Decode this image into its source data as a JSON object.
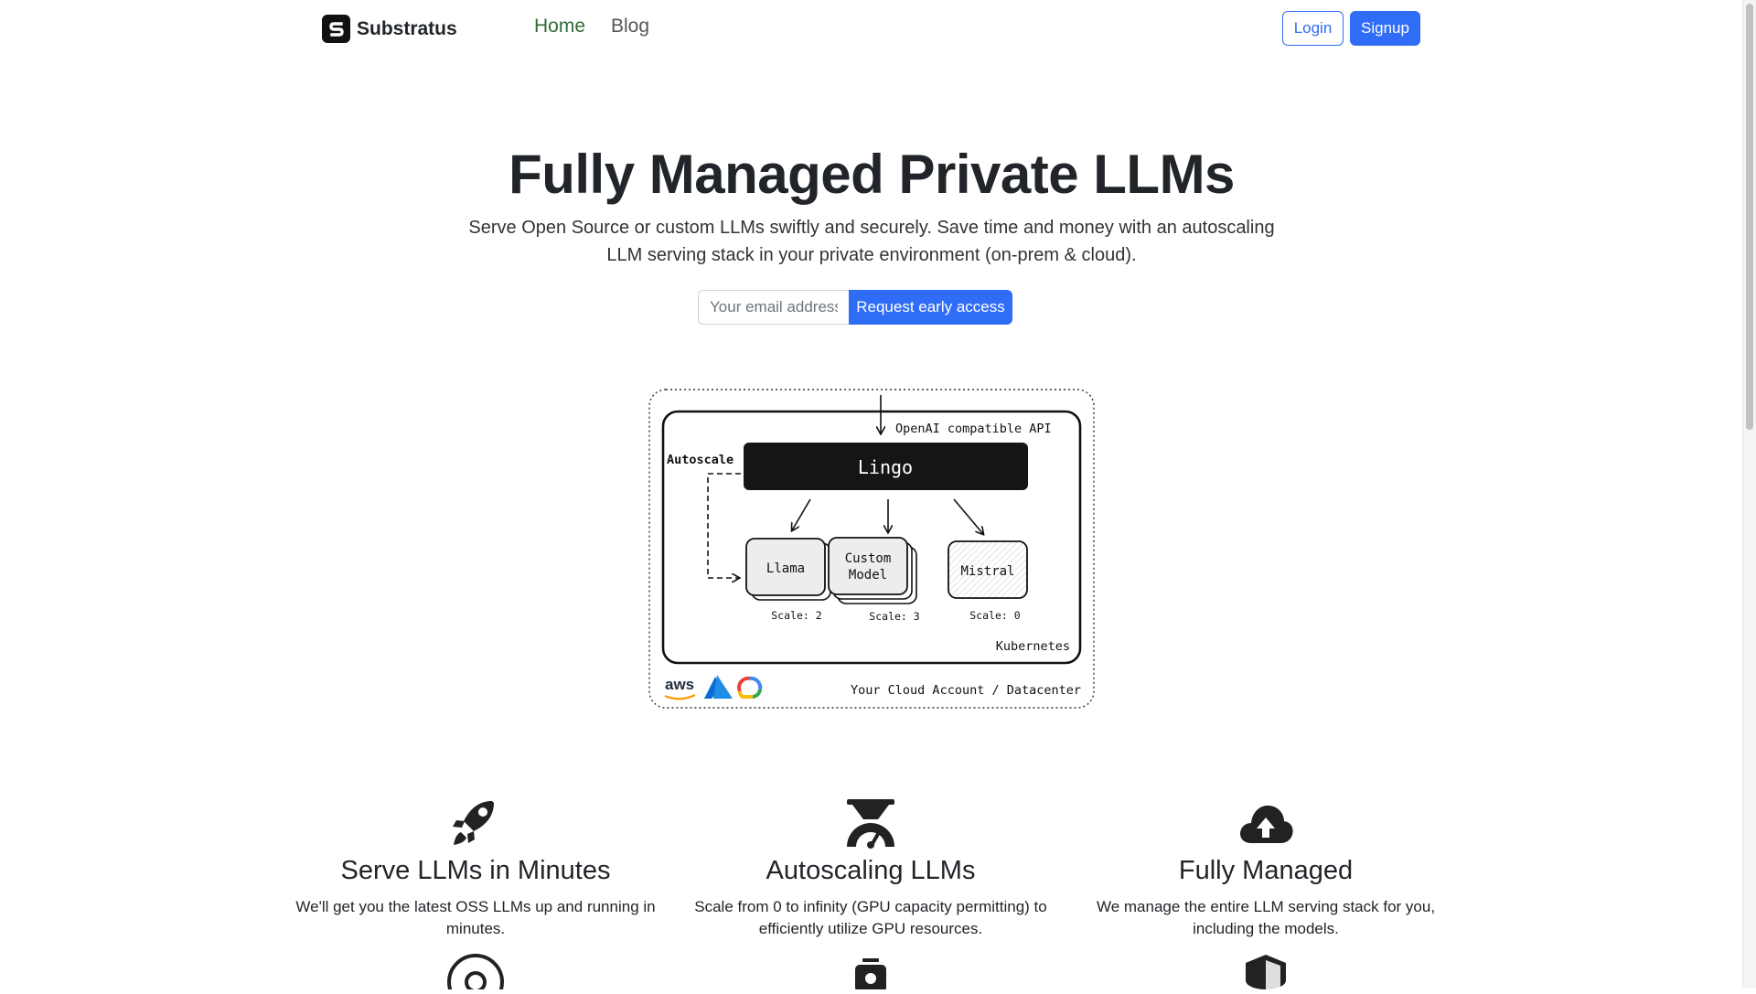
{
  "nav": {
    "brand": "Substratus",
    "links": [
      {
        "label": "Home",
        "active": true
      },
      {
        "label": "Blog",
        "active": false
      }
    ],
    "login_label": "Login",
    "signup_label": "Signup"
  },
  "hero": {
    "title": "Fully Managed Private LLMs",
    "subtitle": "Serve Open Source or custom LLMs swiftly and securely. Save time and money with an autoscaling LLM serving stack in your private environment (on-prem & cloud).",
    "email_placeholder": "Your email address",
    "email_value": "",
    "cta_label": "Request early access"
  },
  "diagram": {
    "api_label": "OpenAI compatible API",
    "router_label": "Lingo",
    "autoscale_label": "Autoscale",
    "models": [
      {
        "name": "Llama",
        "scale": "Scale: 2"
      },
      {
        "name_line1": "Custom",
        "name_line2": "Model",
        "scale": "Scale: 3"
      },
      {
        "name": "Mistral",
        "scale": "Scale: 0"
      }
    ],
    "cluster_label": "Kubernetes",
    "cloud_label": "Your Cloud Account / Datacenter",
    "aws_label": "aws"
  },
  "features": [
    {
      "icon": "rocket-icon",
      "title": "Serve LLMs in Minutes",
      "text": "We'll get you the latest OSS LLMs up and running in minutes."
    },
    {
      "icon": "scale-gauge-icon",
      "title": "Autoscaling LLMs",
      "text": "Scale from 0 to infinity (GPU capacity permitting) to efficiently utilize GPU resources."
    },
    {
      "icon": "cloud-upload-icon",
      "title": "Fully Managed",
      "text": "We manage the entire LLM serving stack for you, including the models."
    }
  ],
  "colors": {
    "primary": "#2f6df6",
    "active_nav": "#2e6b35",
    "text": "#212529"
  }
}
